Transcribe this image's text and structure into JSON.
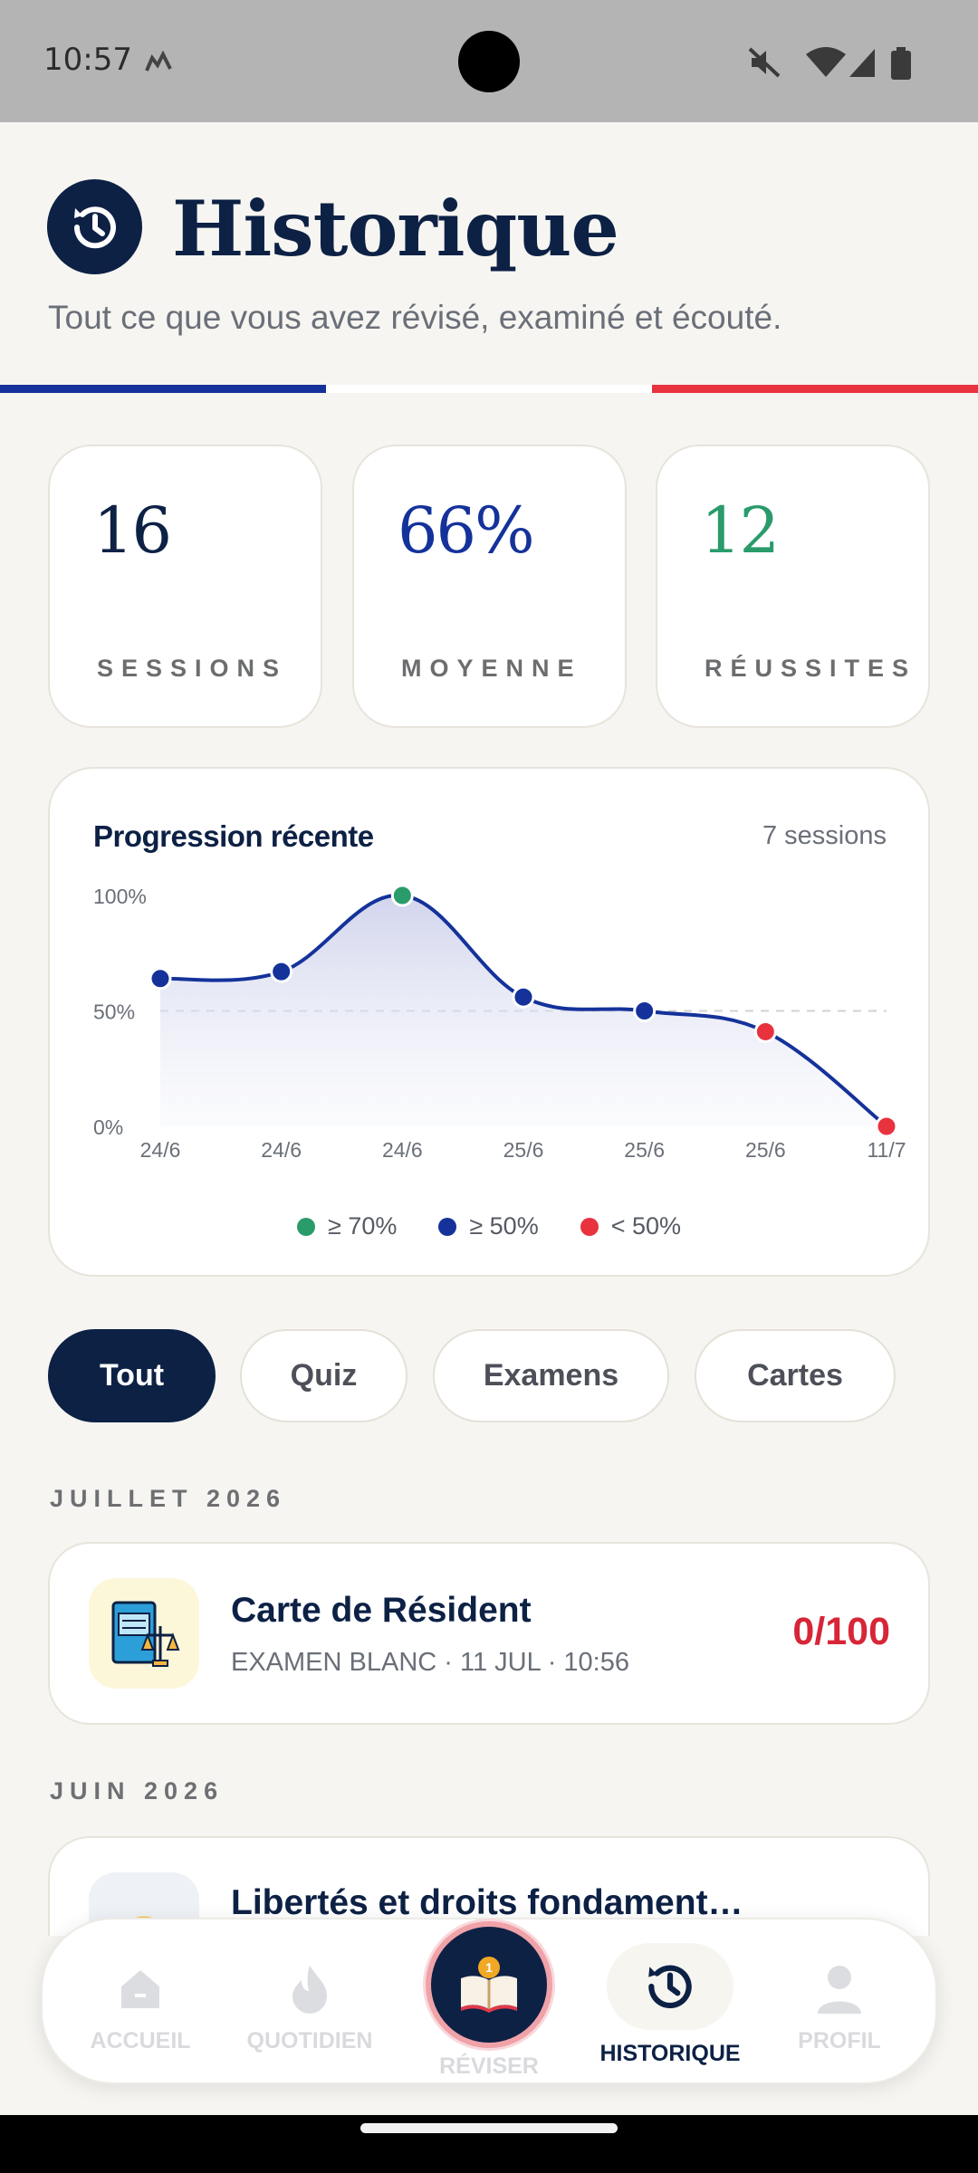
{
  "status_bar": {
    "time": "10:57"
  },
  "header": {
    "title": "Historique",
    "subtitle": "Tout ce que vous avez révisé, examiné et écouté."
  },
  "stats": [
    {
      "value": "16",
      "label": "SESSIONS",
      "color": "#0d2145"
    },
    {
      "value": "66%",
      "label": "MOYENNE",
      "color": "#14329a"
    },
    {
      "value": "12",
      "label": "RÉUSSITES",
      "color": "#2a9b6b"
    }
  ],
  "chart_data": {
    "type": "line",
    "title": "Progression récente",
    "count_label": "7 sessions",
    "categories": [
      "24/6",
      "24/6",
      "24/6",
      "25/6",
      "25/6",
      "25/6",
      "11/7"
    ],
    "values": [
      64,
      67,
      100,
      56,
      50,
      41,
      0
    ],
    "ylim": [
      0,
      100
    ],
    "yticks": [
      "100%",
      "50%",
      "0%"
    ],
    "reference_line": 50,
    "legend": [
      {
        "label": "≥ 70%",
        "color": "#2a9b6b"
      },
      {
        "label": "≥ 50%",
        "color": "#14329a"
      },
      {
        "label": "< 50%",
        "color": "#e8333f"
      }
    ]
  },
  "filters": [
    "Tout",
    "Quiz",
    "Examens",
    "Cartes"
  ],
  "active_filter": "Tout",
  "sections": [
    {
      "month": "JUILLET 2026",
      "items": [
        {
          "title": "Carte de Résident",
          "meta": "EXAMEN BLANC · 11 JUL · 10:56",
          "score": "0/100",
          "icon": "civil-law-book-icon"
        }
      ]
    },
    {
      "month": "JUIN 2026",
      "items": [
        {
          "title": "Libertés et droits fondament…",
          "meta": "",
          "score": "",
          "icon": "globe-icon"
        }
      ]
    }
  ],
  "nav": {
    "items": [
      {
        "label": "ACCUEIL",
        "icon": "home-icon"
      },
      {
        "label": "QUOTIDIEN",
        "icon": "flame-icon"
      },
      {
        "label": "RÉVISER",
        "icon": "open-book-icon"
      },
      {
        "label": "HISTORIQUE",
        "icon": "history-icon"
      },
      {
        "label": "PROFIL",
        "icon": "profile-icon"
      }
    ],
    "active": "HISTORIQUE"
  },
  "colors": {
    "navy": "#0d2145",
    "blue": "#14329a",
    "green": "#2a9b6b",
    "red": "#e8333f",
    "background": "#f6f5f1"
  }
}
